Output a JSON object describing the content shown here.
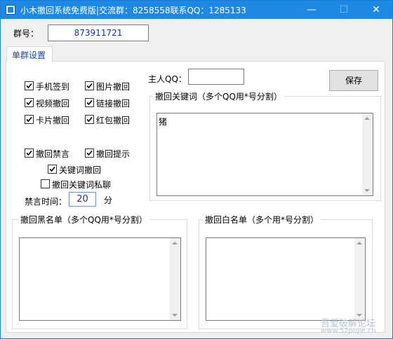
{
  "window": {
    "title": "小木撤回系统免费版|交流群：8258558联系QQ：1285133",
    "minimize_glyph": "—",
    "maximize_glyph": "☐",
    "close_glyph": "✕"
  },
  "group_number": {
    "label": "群号：",
    "value": "873911721"
  },
  "tab": {
    "label": "单群设置"
  },
  "checkboxes": {
    "phone_checkin": {
      "label": "手机签到",
      "checked": true
    },
    "image_recall": {
      "label": "图片撤回",
      "checked": true
    },
    "video_recall": {
      "label": "视频撤回",
      "checked": true
    },
    "link_recall": {
      "label": "链接撤回",
      "checked": true
    },
    "card_recall": {
      "label": "卡片撤回",
      "checked": true
    },
    "redpacket_recall": {
      "label": "红包撤回",
      "checked": true
    },
    "recall_mute": {
      "label": "撤回禁言",
      "checked": true
    },
    "recall_notice": {
      "label": "撤回提示",
      "checked": true
    },
    "keyword_recall": {
      "label": "关键词撤回",
      "checked": true
    },
    "keyword_private": {
      "label": "撤回关键词私聊",
      "checked": false
    }
  },
  "mute_time": {
    "label": "禁言时间：",
    "value": "20",
    "unit": "分"
  },
  "owner_qq": {
    "label": "主人QQ：",
    "value": ""
  },
  "save_button": {
    "label": "保存"
  },
  "keywords": {
    "title": "撤回关键词（多个QQ用*号分割）",
    "value": "猪"
  },
  "blacklist": {
    "title": "撤回黑名单（多个QQ用*号分割）",
    "value": ""
  },
  "whitelist": {
    "title": "撤回白名单（多个用*号分割）",
    "value": ""
  },
  "watermark": {
    "line1": "吾爱破解论坛",
    "line2": "www.52pojie.cn"
  },
  "colors": {
    "titlebar": "#1e88e5",
    "accent_text": "#1a2f9e",
    "tab_text": "#1a3db0"
  }
}
